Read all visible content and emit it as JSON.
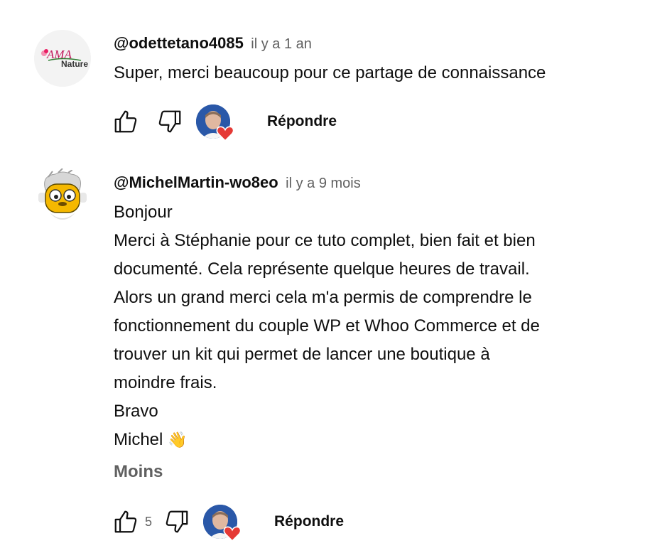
{
  "comments": [
    {
      "author": "@odettetano4085",
      "time": "il y a 1 an",
      "avatar_text_top": "AMA",
      "avatar_text_bottom": "Nature",
      "text": "Super, merci beaucoup pour ce partage de connaissance",
      "reply_label": "Répondre"
    },
    {
      "author": "@MichelMartin-wo8eo",
      "time": "il y a 9 mois",
      "lines": [
        "Bonjour",
        "Merci à Stéphanie pour ce tuto complet, bien fait et bien",
        "documenté. Cela représente quelque heures de travail.",
        "Alors un grand merci cela m'a permis de comprendre le",
        "fonctionnement du couple WP et Whoo Commerce et de",
        "trouver un kit qui permet de lancer une boutique à",
        "moindre frais.",
        "Bravo",
        "Michel"
      ],
      "emoji": "👋",
      "less_label": "Moins",
      "like_count": "5",
      "reply_label": "Répondre"
    }
  ],
  "colors": {
    "heart": "#e53935",
    "secondary_text": "#606060",
    "ama_pink": "#c2185b",
    "ama_green": "#2e7d32"
  },
  "icons": [
    "thumbs-up-icon",
    "thumbs-down-icon",
    "creator-heart-icon"
  ]
}
